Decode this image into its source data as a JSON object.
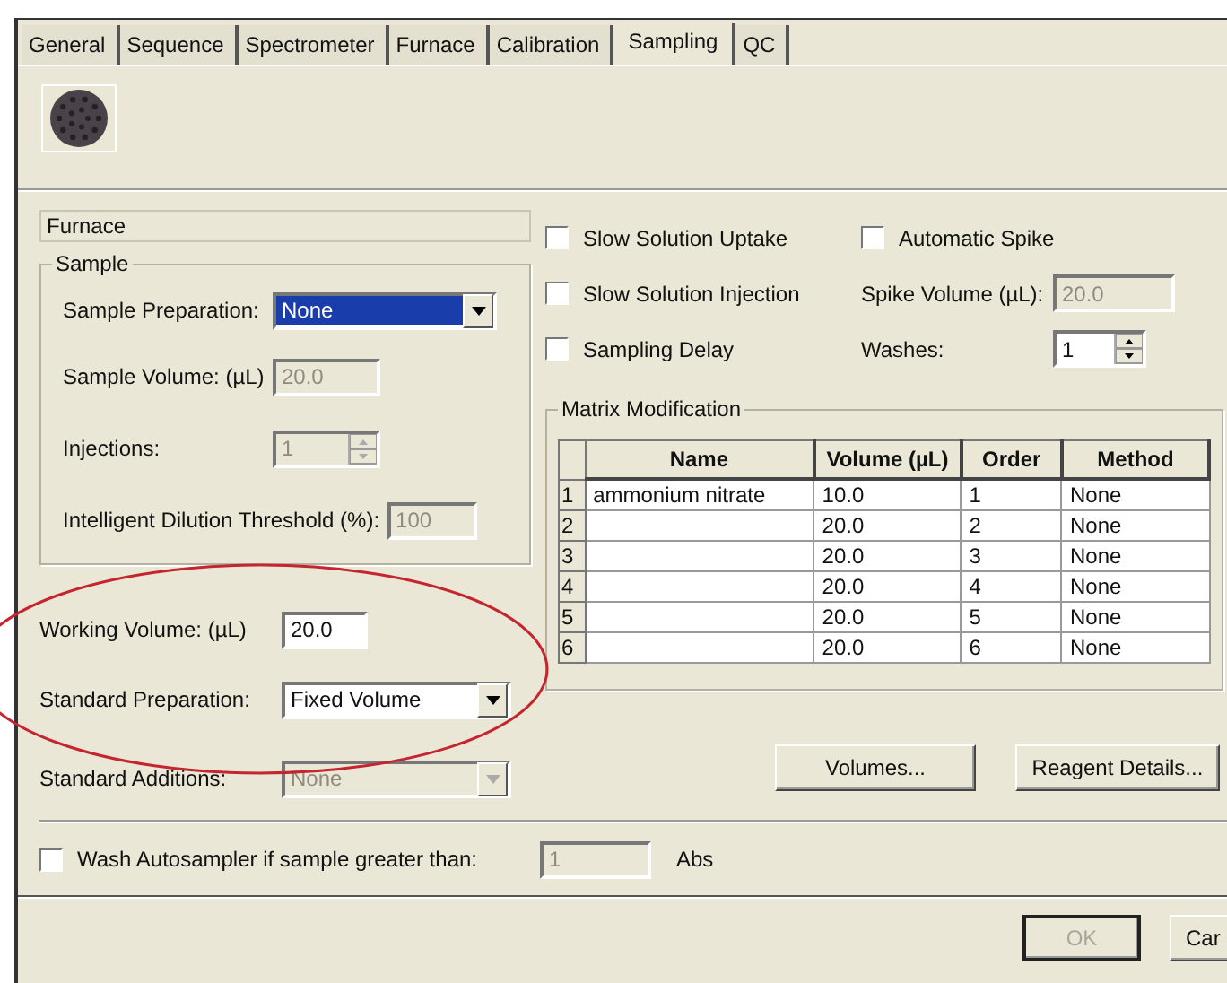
{
  "tabs": [
    {
      "label": "General",
      "selected": false
    },
    {
      "label": "Sequence",
      "selected": false
    },
    {
      "label": "Spectrometer",
      "selected": false
    },
    {
      "label": "Furnace",
      "selected": false
    },
    {
      "label": "Calibration",
      "selected": false
    },
    {
      "label": "Sampling",
      "selected": true
    },
    {
      "label": "QC",
      "selected": false
    }
  ],
  "section_title": "Furnace",
  "sample_group": {
    "title": "Sample",
    "fields": [
      {
        "kind": "dropdown",
        "label": "Sample Preparation:",
        "value": "None",
        "disabled": false,
        "text_selected": true
      },
      {
        "kind": "text",
        "label": "Sample Volume: (µL)",
        "value": "20.0",
        "disabled": true
      },
      {
        "kind": "spinner",
        "label": "Injections:",
        "value": "1",
        "disabled": true
      },
      {
        "kind": "text",
        "label": "Intelligent Dilution Threshold (%):",
        "value": "100",
        "disabled": true
      }
    ]
  },
  "standard_fields": [
    {
      "kind": "text",
      "label": "Working Volume: (µL)",
      "value": "20.0",
      "disabled": false
    },
    {
      "kind": "dropdown",
      "label": "Standard Preparation:",
      "value": "Fixed Volume",
      "disabled": false,
      "text_selected": false
    },
    {
      "kind": "dropdown",
      "label": "Standard Additions:",
      "value": "None",
      "disabled": true,
      "text_selected": false
    }
  ],
  "options": [
    {
      "label": "Slow Solution Uptake",
      "checked": false
    },
    {
      "label": "Slow Solution Injection",
      "checked": false
    },
    {
      "label": "Sampling Delay",
      "checked": false
    }
  ],
  "spike": {
    "automatic_spike": {
      "label": "Automatic Spike",
      "checked": false
    },
    "fields": [
      {
        "kind": "text",
        "label": "Spike Volume (µL):",
        "value": "20.0",
        "disabled": true
      },
      {
        "kind": "spinner",
        "label": "Washes:",
        "value": "1",
        "disabled": false
      }
    ]
  },
  "matrix_modification": {
    "title": "Matrix Modification",
    "columns": [
      "Name",
      "Volume (µL)",
      "Order",
      "Method"
    ],
    "rows": [
      {
        "index": "1",
        "name": "ammonium nitrate",
        "volume": "10.0",
        "order": "1",
        "method": "None"
      },
      {
        "index": "2",
        "volume": "20.0",
        "order": "2",
        "method": "None"
      },
      {
        "index": "3",
        "volume": "20.0",
        "order": "3",
        "method": "None"
      },
      {
        "index": "4",
        "volume": "20.0",
        "order": "4",
        "method": "None"
      },
      {
        "index": "5",
        "volume": "20.0",
        "order": "5",
        "method": "None"
      },
      {
        "index": "6",
        "volume": "20.0",
        "order": "6",
        "method": "None"
      }
    ]
  },
  "buttons": [
    "Volumes...",
    "Reagent Details..."
  ],
  "wash": {
    "label": "Wash Autosampler if sample greater than:",
    "checked": false,
    "value": "1",
    "disabled": true,
    "unit": "Abs"
  },
  "footer_buttons": [
    {
      "label": "OK",
      "disabled": true
    },
    {
      "label": "Car",
      "disabled": false
    }
  ]
}
